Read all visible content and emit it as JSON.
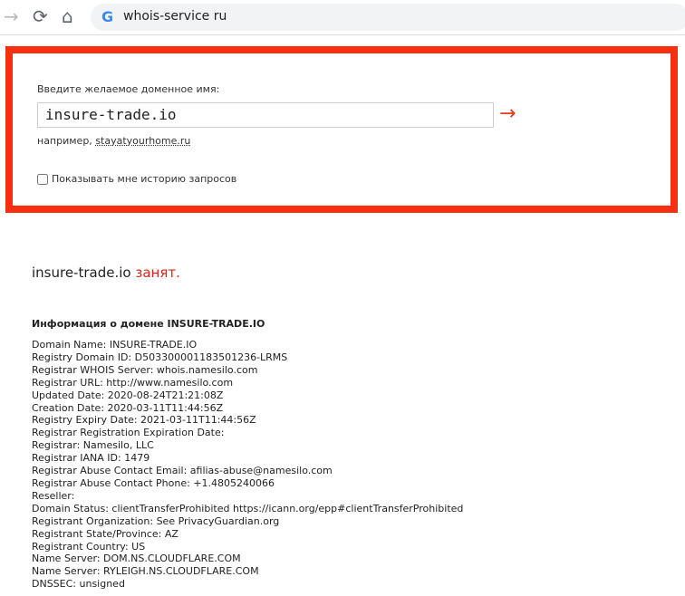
{
  "browser": {
    "url": "whois-service ru"
  },
  "form": {
    "label": "Введите желаемое доменное имя:",
    "value": "insure-trade.io",
    "submit": "→",
    "example_prefix": "например,",
    "example_link": "stayatyourhome.ru",
    "history_label": "Показывать мне историю запросов"
  },
  "result": {
    "domain": "insure-trade.io",
    "status": "занят."
  },
  "info": {
    "title": "Информация о домене INSURE-TRADE.IO",
    "lines": [
      "Domain Name: INSURE-TRADE.IO",
      "Registry Domain ID: D503300001183501236-LRMS",
      "Registrar WHOIS Server: whois.namesilo.com",
      "Registrar URL: http://www.namesilo.com",
      "Updated Date: 2020-08-24T21:21:08Z",
      "Creation Date: 2020-03-11T11:44:56Z",
      "Registry Expiry Date: 2021-03-11T11:44:56Z",
      "Registrar Registration Expiration Date:",
      "Registrar: Namesilo, LLC",
      "Registrar IANA ID: 1479",
      "Registrar Abuse Contact Email: afilias-abuse@namesilo.com",
      "Registrar Abuse Contact Phone: +1.4805240066",
      "Reseller:",
      "Domain Status: clientTransferProhibited https://icann.org/epp#clientTransferProhibited",
      "Registrant Organization: See PrivacyGuardian.org",
      "Registrant State/Province: AZ",
      "Registrant Country: US",
      "Name Server: DOM.NS.CLOUDFLARE.COM",
      "Name Server: RYLEIGH.NS.CLOUDFLARE.COM",
      "DNSSEC: unsigned"
    ]
  }
}
